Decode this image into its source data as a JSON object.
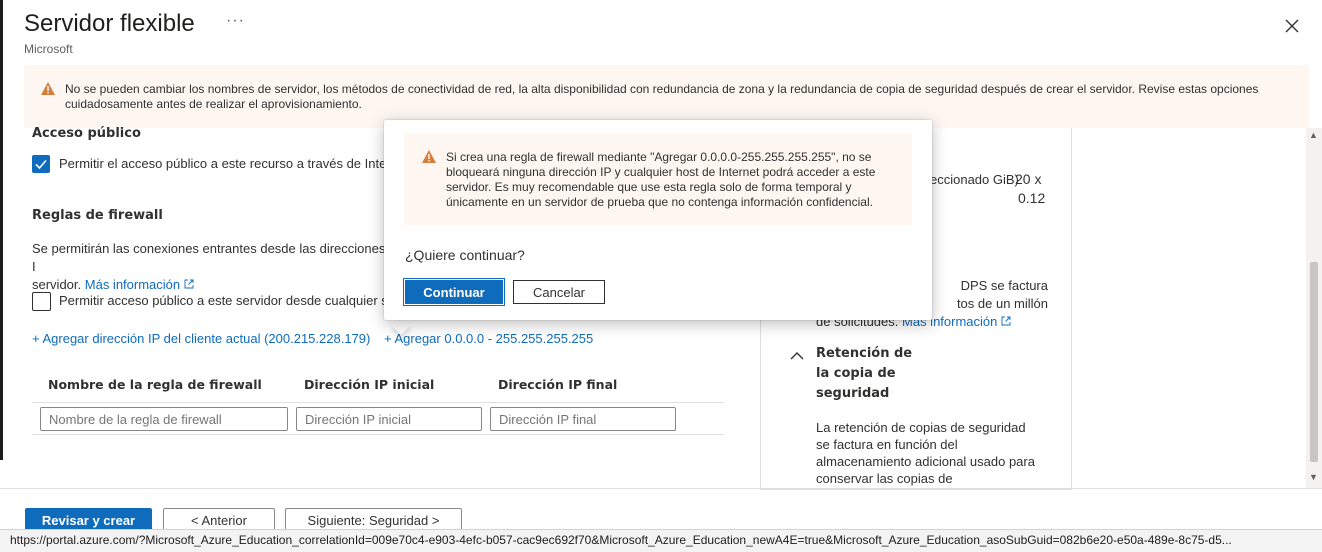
{
  "header": {
    "title": "Servidor flexible",
    "more": "···",
    "subtitle": "Microsoft"
  },
  "banner": {
    "text": "No se pueden cambiar los nombres de servidor, los métodos de conectividad de red, la alta disponibilidad con redundancia de zona y la redundancia de copia de seguridad después de crear el servidor. Revise estas opciones cuidadosamente antes de realizar el aprovisionamiento."
  },
  "public_access": {
    "title": "Acceso público",
    "checkbox_label": "Permitir el acceso público a este recurso a través de Inter",
    "checked": true
  },
  "firewall": {
    "title": "Reglas de firewall",
    "desc_line1": "Se permitirán las conexiones entrantes desde las direcciones I",
    "desc_line2": "servidor.",
    "more_info": "Más información",
    "server_checkbox_label": "Permitir acceso público a este servidor desde cualquier s",
    "server_checked": false,
    "add_client_ip": "+ Agregar dirección IP del cliente actual (200.215.228.179)",
    "add_all_ip": "+ Agregar 0.0.0.0 - 255.255.255.255",
    "columns": [
      "Nombre de la regla de firewall",
      "Dirección IP inicial",
      "Dirección IP final"
    ],
    "placeholders": [
      "Nombre de la regla de firewall",
      "Dirección IP inicial",
      "Dirección IP final"
    ]
  },
  "summary": {
    "capacity_label": "eccionado GiB)",
    "capacity_val1": "20 x",
    "capacity_val2": "0.12",
    "iops_text_l1": "DPS se factura",
    "iops_text_l2": "tos de un millón",
    "iops_text_l3": "de solicitudes.",
    "iops_more": "Más información",
    "retention_title": "Retención de la copia de seguridad",
    "retention_desc": "La retención de copias de seguridad se factura en función del almacenamiento adicional usado para conservar las copias de"
  },
  "dialog": {
    "warning": "Si crea una regla de firewall mediante \"Agregar 0.0.0.0-255.255.255.255\", no se bloqueará ninguna dirección IP y cualquier host de Internet podrá acceder a este servidor. Es muy recomendable que use esta regla solo de forma temporal y únicamente en un servidor de prueba que no contenga información confidencial.",
    "question": "¿Quiere continuar?",
    "continue": "Continuar",
    "cancel": "Cancelar"
  },
  "footer": {
    "review": "Revisar y crear",
    "previous": "< Anterior",
    "next": "Siguiente: Seguridad >"
  },
  "status_url": "https://portal.azure.com/?Microsoft_Azure_Education_correlationId=009e70c4-e903-4efc-b057-cac9ec692f70&Microsoft_Azure_Education_newA4E=true&Microsoft_Azure_Education_asoSubGuid=082b6e20-e50a-489e-8c75-d5...",
  "colors": {
    "accent": "#0f6cbd",
    "warning": "#d67f3c",
    "warning_bg": "#fdf6f1"
  }
}
